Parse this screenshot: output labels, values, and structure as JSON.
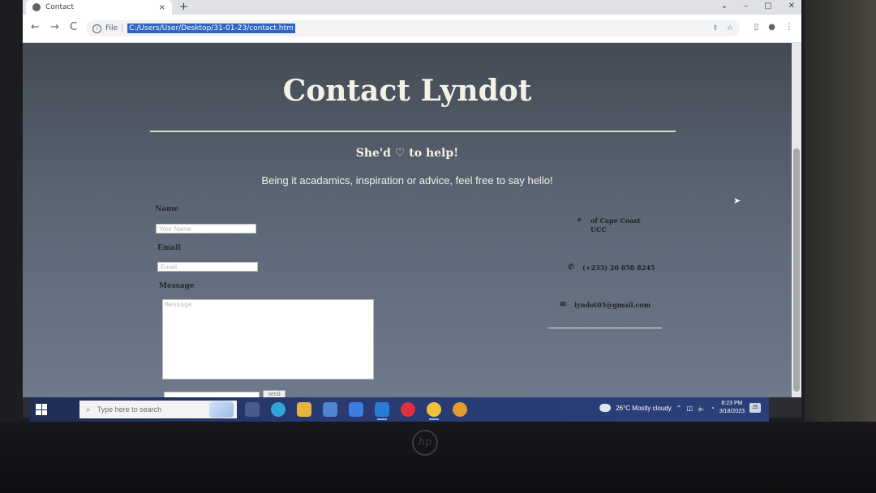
{
  "browser": {
    "tab_title": "Contact",
    "tab_close": "×",
    "new_tab": "+",
    "win_controls": [
      "⌄",
      "–",
      "▢",
      "✕"
    ],
    "back": "←",
    "forward": "→",
    "reload": "C",
    "info_icon": "i",
    "file_label": "File",
    "url": "C:/Users/User/Desktop/31-01-23/contact.htm"
  },
  "page": {
    "title": "Contact Lyndot",
    "tagline": "She'd ♡ to help!",
    "subline": "Being it acadamics, inspiration or advice, feel free to say hello!"
  },
  "form": {
    "name_label": "Name",
    "name_placeholder": "Your Name",
    "email_label": "Email",
    "email_placeholder": "Email",
    "message_label": "Message",
    "message_placeholder": "Message",
    "send_label": "send"
  },
  "contact": {
    "address": "of Cape Coast\nUCC",
    "phone": "(+233) 20 858 8245",
    "email": "lyndot05@gmail.com"
  },
  "taskbar": {
    "search_placeholder": "Type here to search",
    "weather": "26°C  Mostly cloudy",
    "time": "8:23 PM",
    "date": "3/18/2023",
    "notification_count": "25"
  },
  "colors": {
    "page_text": "#f4f1e6",
    "url_highlight": "#2f63c6",
    "taskbar": "#283a70"
  }
}
